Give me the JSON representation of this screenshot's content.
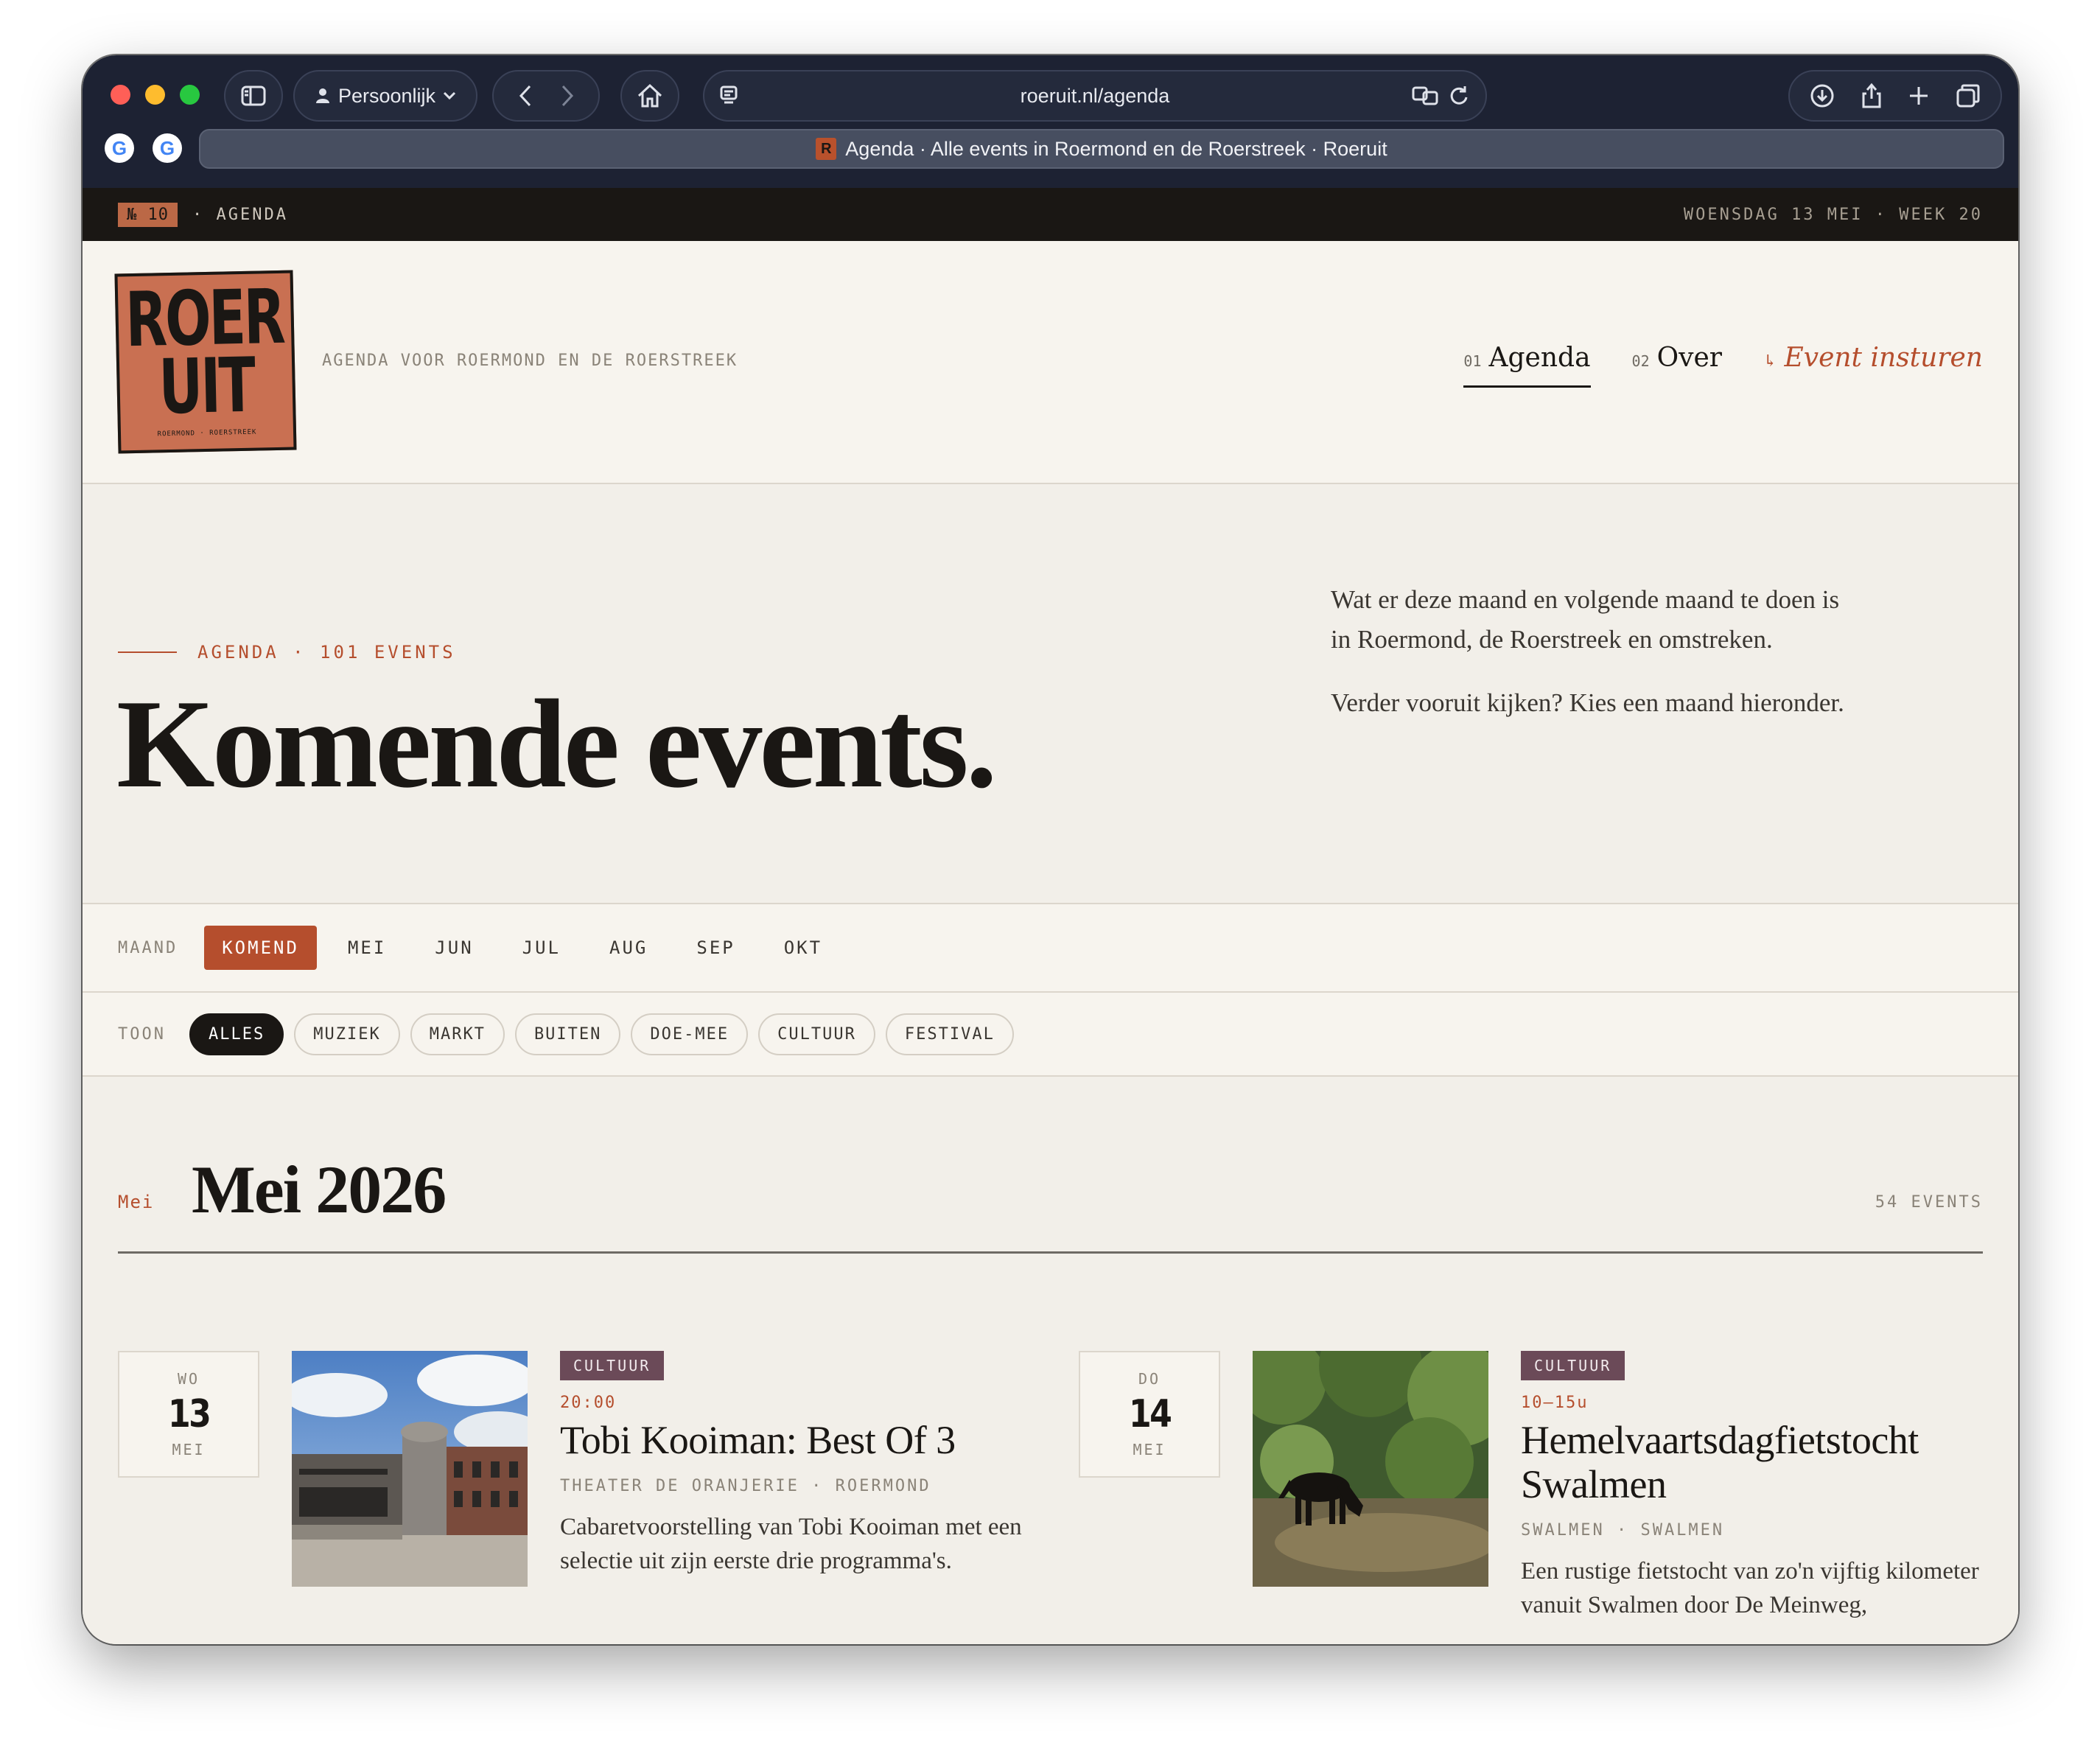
{
  "browser": {
    "profile_label": "Persoonlijk",
    "url": "roeruit.nl/agenda",
    "tab_title": "Agenda · Alle events in Roermond en de Roerstreek · Roeruit",
    "favicon_letter": "R",
    "google_letter": "G"
  },
  "topstrip": {
    "issue": "№ 10",
    "section": "· AGENDA",
    "date": "WOENSDAG 13 MEI · WEEK 20"
  },
  "header": {
    "logo_line1": "ROER",
    "logo_line2": "UIT",
    "logo_small": "ROERMOND · ROERSTREEK",
    "tagline": "AGENDA VOOR ROERMOND EN DE ROERSTREEK",
    "nav": [
      {
        "num": "01",
        "label": "Agenda"
      },
      {
        "num": "02",
        "label": "Over"
      },
      {
        "arrow": "↳",
        "label": "Event insturen"
      }
    ]
  },
  "hero": {
    "eyebrow": "AGENDA · 101 EVENTS",
    "title": "Komende events.",
    "desc_1": "Wat er deze maand en volgende maand te doen is in Roermond, de Roerstreek en omstreken.",
    "desc_2": "Verder vooruit kijken? Kies een maand hieronder."
  },
  "month_filter": {
    "label": "MAAND",
    "items": [
      "KOMEND",
      "MEI",
      "JUN",
      "JUL",
      "AUG",
      "SEP",
      "OKT"
    ],
    "selected": "KOMEND"
  },
  "category_filter": {
    "label": "TOON",
    "items": [
      "ALLES",
      "MUZIEK",
      "MARKT",
      "BUITEN",
      "DOE-MEE",
      "CULTUUR",
      "FESTIVAL"
    ],
    "selected": "ALLES"
  },
  "section": {
    "mono": "Mei",
    "title": "Mei 2026",
    "count": "54 EVENTS"
  },
  "events": [
    {
      "dow": "WO",
      "day": "13",
      "month": "MEI",
      "category": "CULTUUR",
      "time": "20:00",
      "title": "Tobi Kooiman: Best Of 3",
      "location": "THEATER DE ORANJERIE · ROERMOND",
      "desc": "Cabaretvoorstelling van Tobi Kooiman met een selectie uit zijn eerste drie programma's."
    },
    {
      "dow": "DO",
      "day": "14",
      "month": "MEI",
      "category": "CULTUUR",
      "time": "10–15u",
      "title": "Hemelvaartsdagfietstocht Swalmen",
      "location": "SWALMEN · SWALMEN",
      "desc": "Een rustige fietstocht van zo'n vijftig kilometer vanuit Swalmen door De Meinweg,"
    }
  ],
  "colors": {
    "accent": "#b54e2d",
    "page_bg": "#f2efe9",
    "ink": "#1a1714",
    "badge_cultuur": "#6b4a58",
    "chrome_bg": "#1d2233"
  }
}
